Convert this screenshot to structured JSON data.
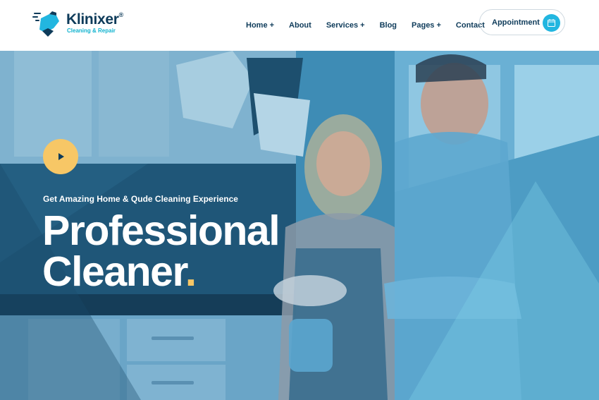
{
  "brand": {
    "name": "Klinixer",
    "reg_mark": "®",
    "tagline": "Cleaning & Repair"
  },
  "nav": {
    "items": [
      {
        "label": "Home +"
      },
      {
        "label": "About"
      },
      {
        "label": "Services +"
      },
      {
        "label": "Blog"
      },
      {
        "label": "Pages +"
      },
      {
        "label": "Contact"
      }
    ]
  },
  "appointment": {
    "label": "Appointment",
    "icon": "calendar-icon"
  },
  "hero": {
    "play_icon": "play-icon",
    "subtitle": "Get Amazing Home & Qude Cleaning Experience",
    "title_line1": "Professional",
    "title_line2": "Cleaner",
    "title_dot": "."
  },
  "colors": {
    "navy": "#0e3b5a",
    "accent_cyan": "#22b6e0",
    "accent_yellow": "#f7c766",
    "overlay_blue": "#2f7ea8"
  }
}
